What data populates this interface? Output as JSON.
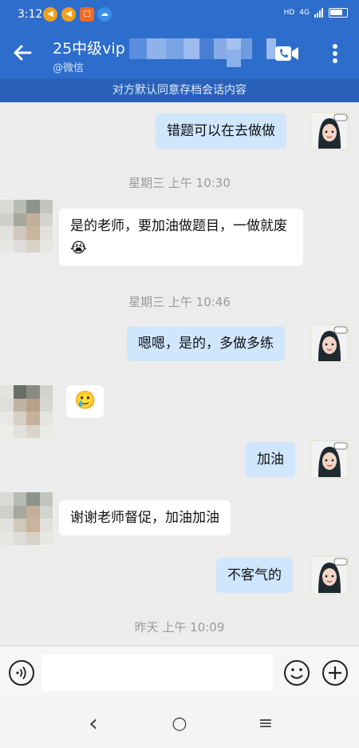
{
  "status_bar": {
    "time": "3:12",
    "network": "4G",
    "hd": "HD",
    "icons": [
      "megaphone-icon",
      "megaphone-icon",
      "app-icon",
      "cloud-icon"
    ]
  },
  "header": {
    "title": "25中级vip",
    "subtitle": "@微信",
    "notice": "对方默认同意存档会话内容",
    "back_icon": "arrow-left-icon",
    "call_icon": "voice-video-call-icon",
    "more_icon": "more-vertical-icon"
  },
  "messages": [
    {
      "id": "m1",
      "direction": "out",
      "text": "错题可以在去做做"
    },
    {
      "id": "t1",
      "type": "timestamp",
      "text": "星期三  上午 10:30"
    },
    {
      "id": "m2",
      "direction": "in",
      "text": "是的老师，要加油做题目，一做就废",
      "emoji": "😭"
    },
    {
      "id": "t2",
      "type": "timestamp",
      "text": "星期三  上午 10:46"
    },
    {
      "id": "m3",
      "direction": "out",
      "text": "嗯嗯，是的，多做多练"
    },
    {
      "id": "m4",
      "direction": "in",
      "text": "",
      "emoji": "🥲"
    },
    {
      "id": "m5",
      "direction": "out",
      "text": "加油"
    },
    {
      "id": "m6",
      "direction": "in",
      "text": "谢谢老师督促，加油加油"
    },
    {
      "id": "m7",
      "direction": "out",
      "text": "不客气的"
    },
    {
      "id": "t3",
      "type": "timestamp",
      "text": "昨天  上午 10:09"
    }
  ],
  "input_bar": {
    "voice_icon": "voice-input-icon",
    "text": "",
    "emoji_icon": "smile-icon",
    "plus_icon": "plus-icon"
  },
  "nav_bar": {
    "back": "‹",
    "home": "○",
    "menu": "≡"
  },
  "colors": {
    "header": "#2d6dcb",
    "notice": "#2a62b9",
    "outgoing_bubble": "#cfe6fd",
    "incoming_bubble": "#ffffff",
    "background": "#ececec"
  }
}
